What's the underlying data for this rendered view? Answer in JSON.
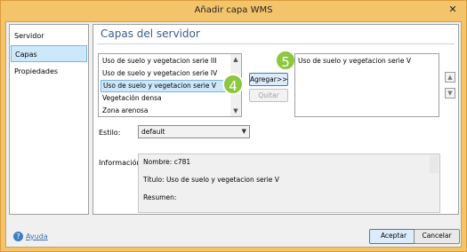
{
  "window": {
    "title": "Añadir capa WMS",
    "close_glyph": "✕"
  },
  "nav": {
    "items": [
      {
        "label": "Servidor"
      },
      {
        "label": "Capas"
      },
      {
        "label": "Propiedades"
      }
    ],
    "selected_index": 1
  },
  "panel": {
    "title": "Capas del servidor",
    "available_layers": [
      "Uso de suelo y vegetacion serie III",
      "Uso de suelo y vegetacion serie IV",
      "Uso de suelo y vegetacion serie V",
      "Vegetación densa",
      "Zona arenosa"
    ],
    "selected_layer_index": 2,
    "add_button": "Agregar>>",
    "remove_button": "Quitar",
    "selected_layers": [
      "Uso de suelo y vegetacion serie V"
    ],
    "style_label": "Estilo:",
    "style_value": "default",
    "info_label": "Información:",
    "info_lines": [
      "Nombre: c781",
      "Título: Uso de suelo y vegetacion serie V",
      "Resumen:"
    ]
  },
  "badges": {
    "step_4": "4",
    "step_5": "5",
    "color": "#8dc63f"
  },
  "footer": {
    "help_label": "Ayuda",
    "ok_button": "Aceptar",
    "cancel_button": "Cancelar"
  }
}
